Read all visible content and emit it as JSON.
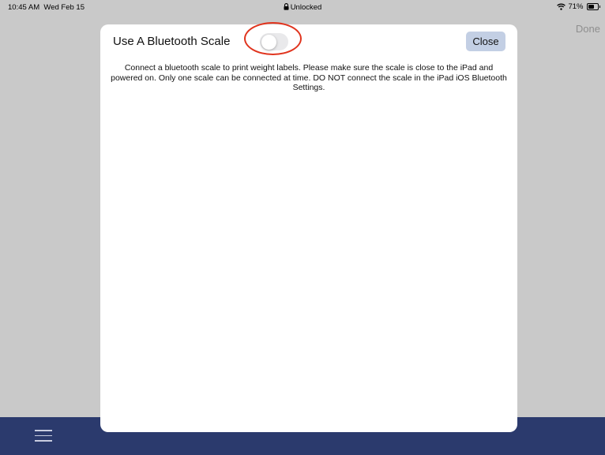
{
  "status_bar": {
    "time": "10:45 AM",
    "date": "Wed Feb 15",
    "center": "Unlocked",
    "battery": "71%",
    "battery_level": 0.71
  },
  "header": {
    "done_label": "Done"
  },
  "modal": {
    "title": "Use A Bluetooth Scale",
    "toggle_on": false,
    "close_label": "Close",
    "description": "Connect a bluetooth scale to print weight labels. Please make sure the scale is close to the iPad and powered on. Only one scale can be connected at time. DO NOT connect the scale in the iPad iOS Bluetooth Settings."
  },
  "bottom_bar": {
    "menu_icon": "hamburger-menu-icon"
  },
  "colors": {
    "accent_bar": "#2b3a6d",
    "close_button": "#c3cfe4",
    "annotation": "#e0341e",
    "toggle_off": "#e9e9eb"
  }
}
